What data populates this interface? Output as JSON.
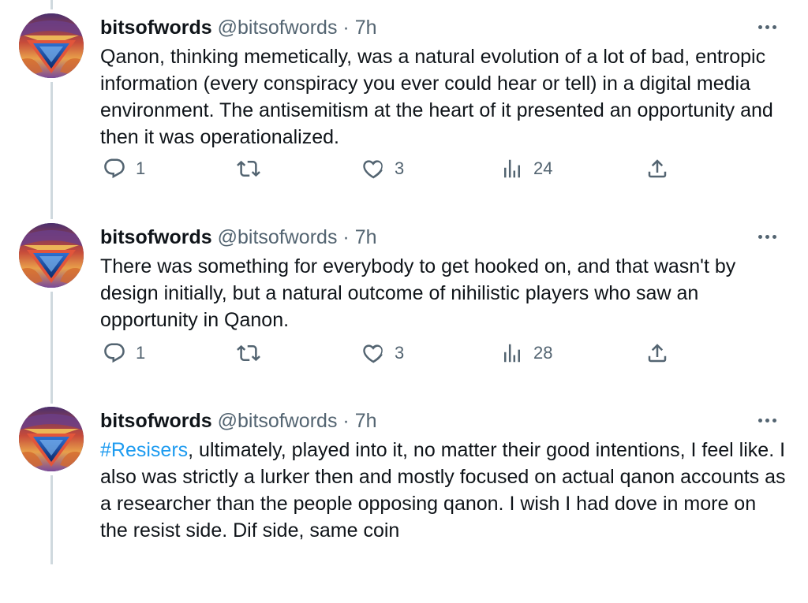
{
  "tweets": [
    {
      "name": "bitsofwords",
      "handle": "@bitsofwords",
      "separator": "·",
      "time": "7h",
      "text": "Qanon, thinking memetically, was a natural evolution of a lot of bad, entropic information (every conspiracy you ever could hear or tell) in a digital media environment. The antisemitism at the heart of it presented an opportunity and then it was operationalized.",
      "hashtag": "",
      "replies": "1",
      "retweets": "",
      "likes": "3",
      "views": "24"
    },
    {
      "name": "bitsofwords",
      "handle": "@bitsofwords",
      "separator": "·",
      "time": "7h",
      "text": "There was something for everybody to get hooked on, and that wasn't by design initially, but a natural outcome of nihilistic players who saw an opportunity in Qanon.",
      "hashtag": "",
      "replies": "1",
      "retweets": "",
      "likes": "3",
      "views": "28"
    },
    {
      "name": "bitsofwords",
      "handle": "@bitsofwords",
      "separator": "·",
      "time": "7h",
      "text": ", ultimately, played  into it, no matter their good intentions, I feel like. I also was strictly a lurker then and mostly focused on actual qanon accounts as a researcher than the people opposing qanon. I wish I had dove in more on the resist side. Dif side, same coin",
      "hashtag": "#Resisers",
      "replies": "",
      "retweets": "",
      "likes": "",
      "views": ""
    }
  ],
  "icons": {
    "reply": "reply-icon",
    "retweet": "retweet-icon",
    "like": "heart-icon",
    "views": "views-icon",
    "share": "share-icon",
    "more": "more-icon"
  },
  "colors": {
    "text": "#0f1419",
    "secondary": "#536471",
    "link": "#1d9bf0",
    "thread_line": "#cfd9de"
  }
}
